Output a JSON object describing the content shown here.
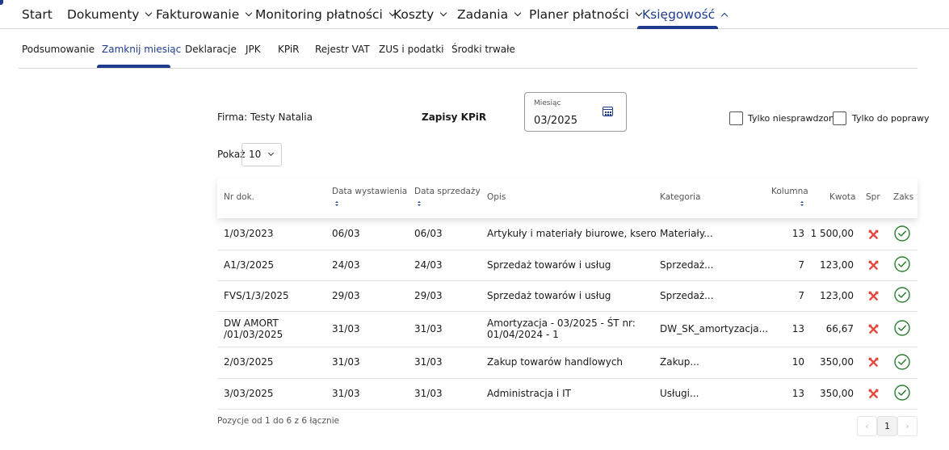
{
  "top_nav": {
    "items": [
      {
        "label": "Start"
      },
      {
        "label": "Dokumenty"
      },
      {
        "label": "Fakturowanie"
      },
      {
        "label": "Monitoring płatności"
      },
      {
        "label": "Koszty"
      },
      {
        "label": "Zadania"
      },
      {
        "label": "Planer płatności"
      },
      {
        "label": "Księgowość"
      }
    ],
    "active": "Księgowość"
  },
  "sub_nav": {
    "items": [
      {
        "label": "Podsumowanie"
      },
      {
        "label": "Zamknij miesiąc"
      },
      {
        "label": "Deklaracje"
      },
      {
        "label": "JPK"
      },
      {
        "label": "KPiR"
      },
      {
        "label": "Rejestr VAT"
      },
      {
        "label": "ZUS i podatki"
      },
      {
        "label": "Środki trwałe"
      }
    ],
    "active": "Zamknij miesiąc"
  },
  "filters": {
    "firma": "Firma: Testy Natalia",
    "section_title": "Zapisy KPiR",
    "month_label": "Miesiąc",
    "month_value": "03/2025",
    "only_unchecked": "Tylko niesprawdzone",
    "only_to_fix": "Tylko do poprawy",
    "show_label": "Pokaż",
    "show_value": "10"
  },
  "table": {
    "headers": {
      "nr": "Nr dok.",
      "data_wyst": "Data wystawienia",
      "data_sprz": "Data sprzedaży",
      "opis": "Opis",
      "kategoria": "Kategoria",
      "kolumna": "Kolumna",
      "kwota": "Kwota",
      "spr": "Spr",
      "zaks": "Zaks"
    },
    "rows": [
      {
        "nr": "1/03/2023",
        "data_wyst": "06/03",
        "data_sprz": "06/03",
        "opis": "Artykuły i materiały biurowe, ksero",
        "kategoria": "Materiały...",
        "kolumna": "13",
        "kwota": "1 500,00"
      },
      {
        "nr": "A1/3/2025",
        "data_wyst": "24/03",
        "data_sprz": "24/03",
        "opis": "Sprzedaż towarów i usług",
        "kategoria": "Sprzedaż...",
        "kolumna": "7",
        "kwota": "123,00"
      },
      {
        "nr": "FVS/1/3/2025",
        "data_wyst": "29/03",
        "data_sprz": "29/03",
        "opis": "Sprzedaż towarów i usług",
        "kategoria": "Sprzedaż...",
        "kolumna": "7",
        "kwota": "123,00"
      },
      {
        "nr_line1": "DW AMORT",
        "nr_line2": "/01/03/2025",
        "data_wyst": "31/03",
        "data_sprz": "31/03",
        "opis_line1": "Amortyzacja - 03/2025 - ŚT nr:",
        "opis_line2": "01/04/2024 - 1",
        "kategoria": "DW_SK_amortyzacja...",
        "kolumna": "13",
        "kwota": "66,67"
      },
      {
        "nr": "2/03/2025",
        "data_wyst": "31/03",
        "data_sprz": "31/03",
        "opis": "Zakup towarów handlowych",
        "kategoria": "Zakup...",
        "kolumna": "10",
        "kwota": "350,00"
      },
      {
        "nr": "3/03/2025",
        "data_wyst": "31/03",
        "data_sprz": "31/03",
        "opis": "Administracja i IT",
        "kategoria": "Usługi...",
        "kolumna": "13",
        "kwota": "350,00"
      }
    ]
  },
  "footer": {
    "summary": "Pozycje od 1 do 6 z 6 łącznie",
    "prev": "‹",
    "page": "1",
    "next": "›"
  },
  "icons": {
    "spr": "tools-icon",
    "zaks": "check-circle-icon",
    "month": "calendar-icon"
  },
  "colors": {
    "accent": "#1f3c8c",
    "spr_icon": "#e8483b",
    "zaks_icon": "#2e7d32"
  }
}
